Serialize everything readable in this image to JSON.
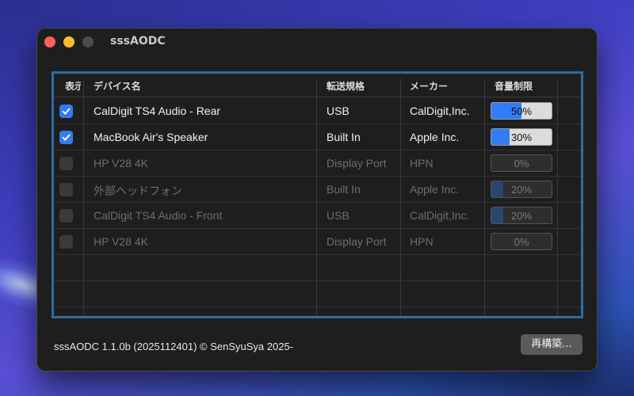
{
  "window": {
    "title": "sssAODC"
  },
  "table": {
    "headers": [
      "表示",
      "デバイス名",
      "転送規格",
      "メーカー",
      "音量制限"
    ],
    "rows": [
      {
        "checked": true,
        "active": true,
        "name": "CalDigit TS4 Audio - Rear",
        "transport": "USB",
        "maker": "CalDigit,Inc.",
        "volume": 50,
        "volume_label": "50%"
      },
      {
        "checked": true,
        "active": true,
        "name": "MacBook Air's Speaker",
        "transport": "Built In",
        "maker": "Apple Inc.",
        "volume": 30,
        "volume_label": "30%"
      },
      {
        "checked": false,
        "active": false,
        "name": "HP V28 4K",
        "transport": "Display Port",
        "maker": "HPN",
        "volume": 0,
        "volume_label": "0%"
      },
      {
        "checked": false,
        "active": false,
        "name": "外部ヘッドフォン",
        "transport": "Built In",
        "maker": "Apple Inc.",
        "volume": 20,
        "volume_label": "20%"
      },
      {
        "checked": false,
        "active": false,
        "name": "CalDigit TS4 Audio - Front",
        "transport": "USB",
        "maker": "CalDigit,Inc.",
        "volume": 20,
        "volume_label": "20%"
      },
      {
        "checked": false,
        "active": false,
        "name": "HP V28 4K",
        "transport": "Display Port",
        "maker": "HPN",
        "volume": 0,
        "volume_label": "0%"
      }
    ]
  },
  "footer": {
    "version_text": "sssAODC 1.1.0b (2025112401) © SenSyuSya 2025-",
    "rebuild_label": "再構築..."
  },
  "colors": {
    "accent": "#2f7cf6",
    "table_border": "#2b6ea3"
  }
}
